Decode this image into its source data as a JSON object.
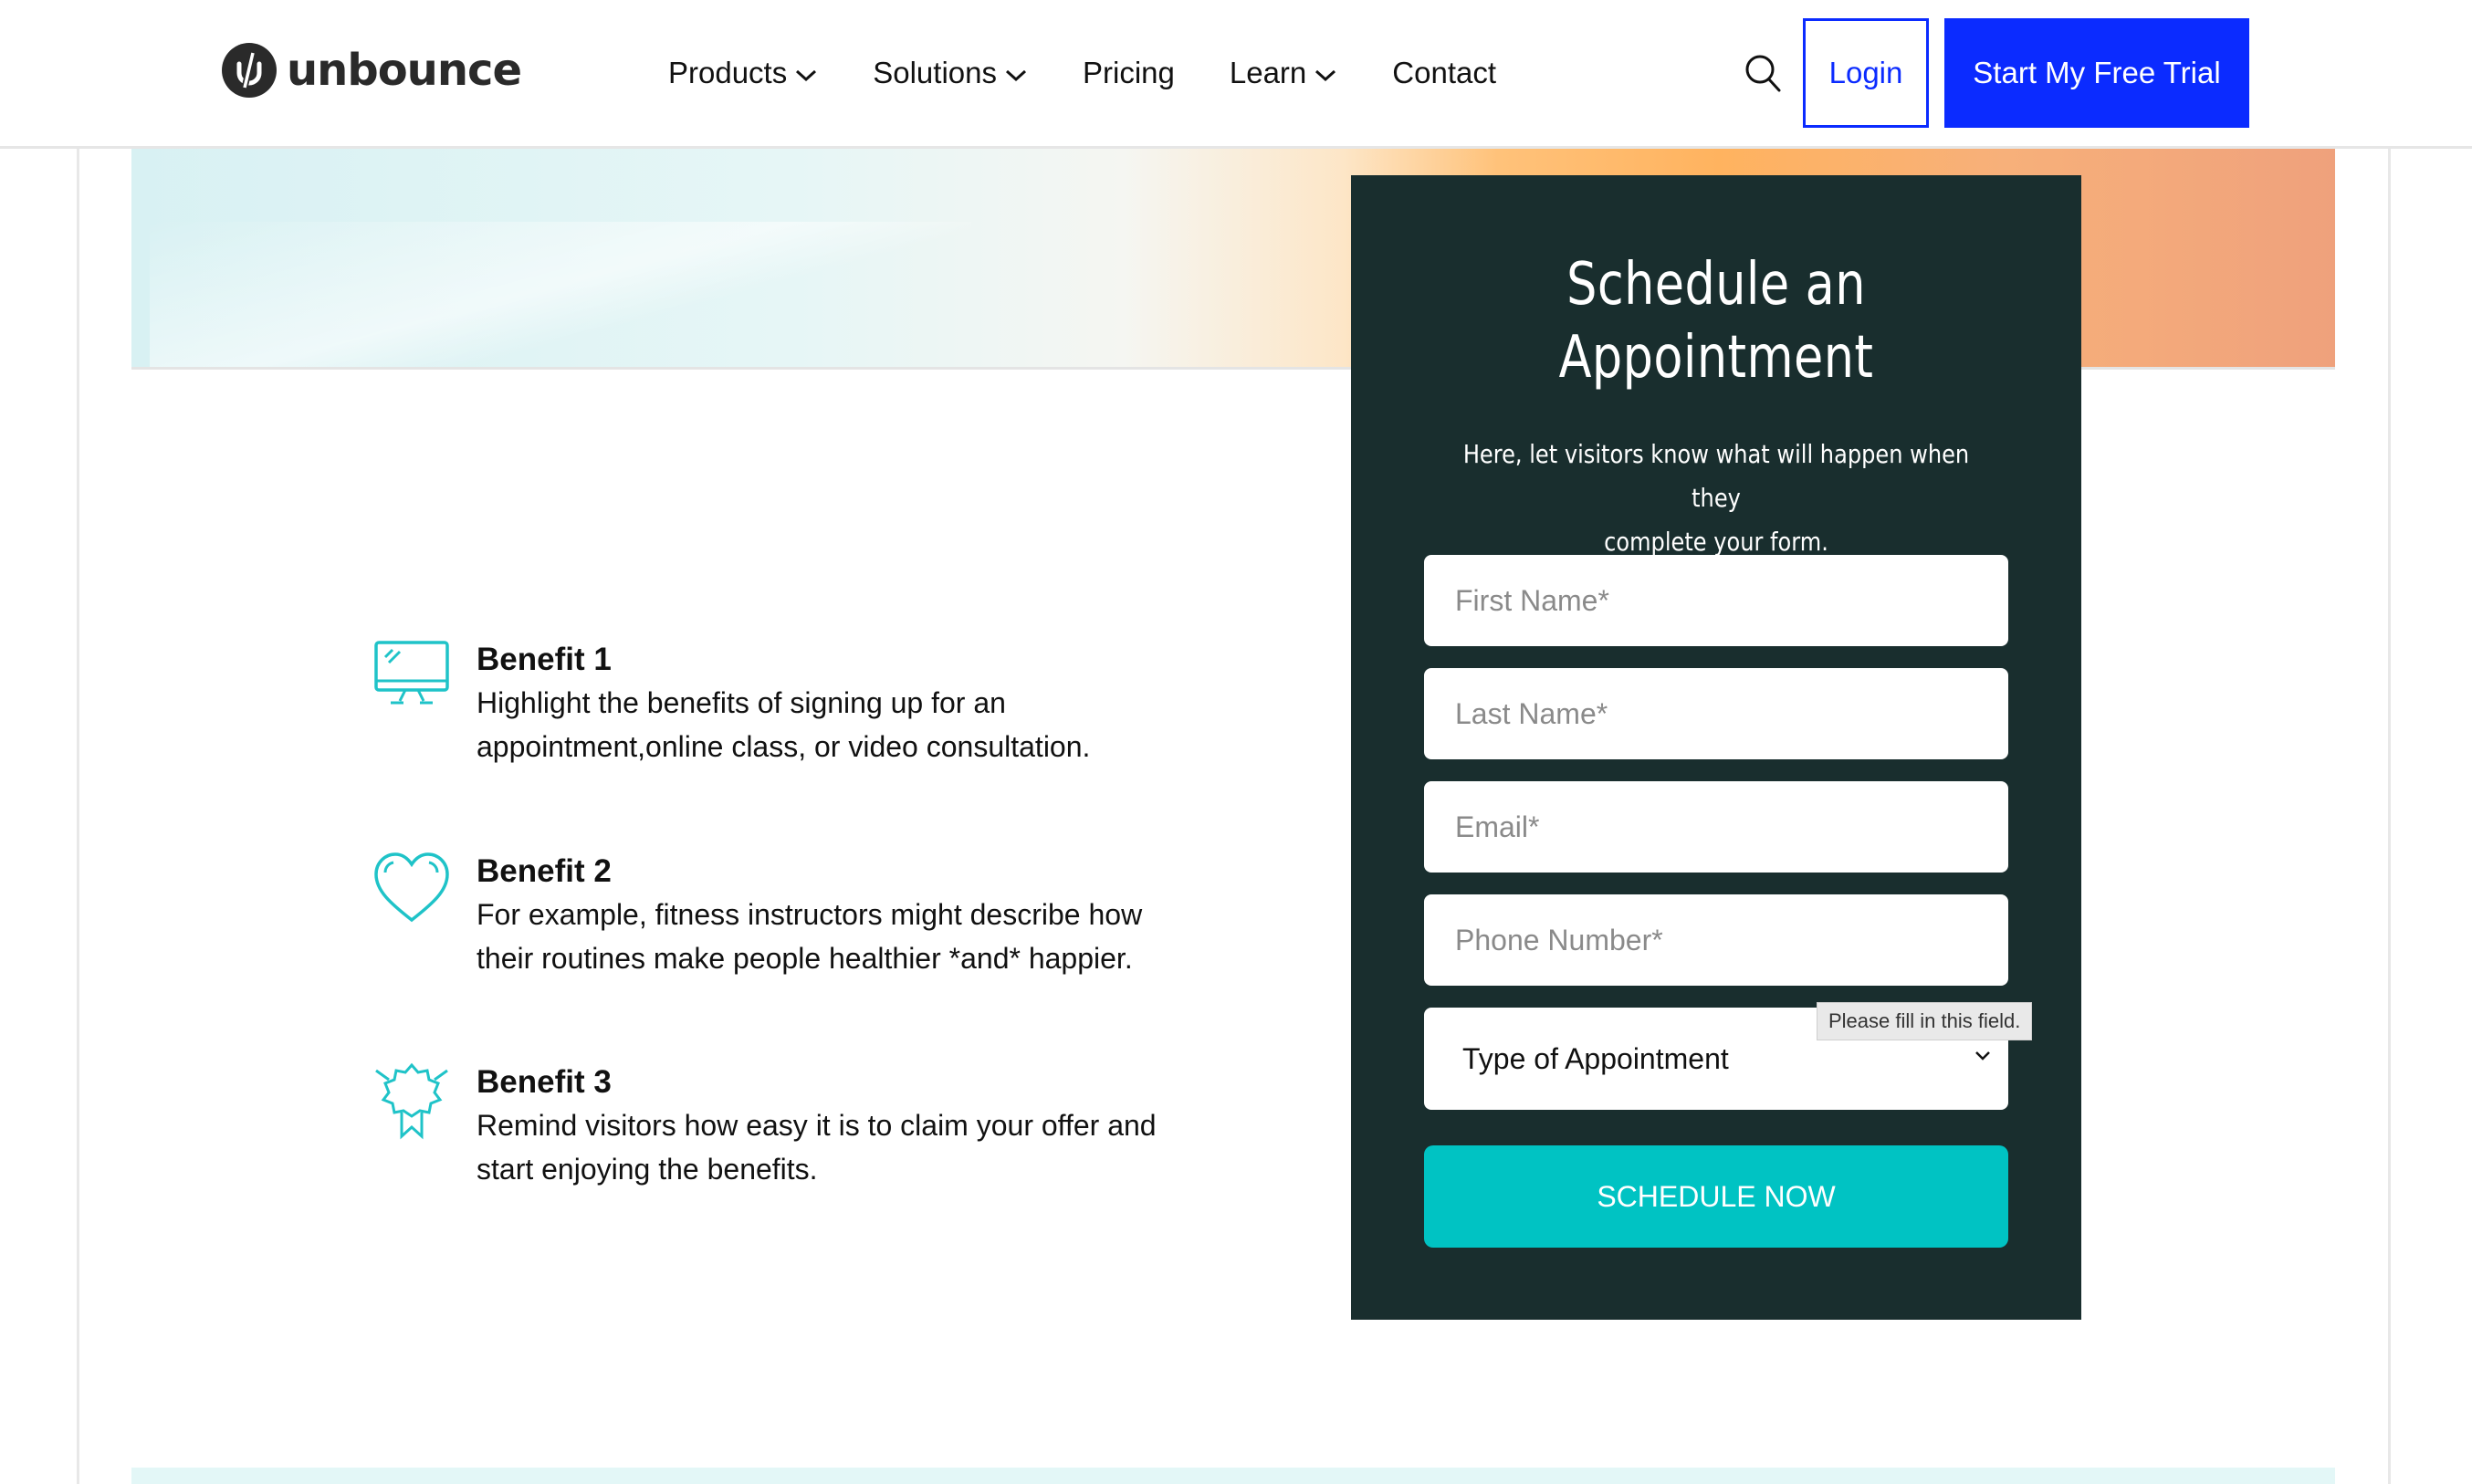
{
  "header": {
    "logo_text": "unbounce",
    "nav": [
      {
        "label": "Products",
        "has_dropdown": true
      },
      {
        "label": "Solutions",
        "has_dropdown": true
      },
      {
        "label": "Pricing",
        "has_dropdown": false
      },
      {
        "label": "Learn",
        "has_dropdown": true
      },
      {
        "label": "Contact",
        "has_dropdown": false
      }
    ],
    "search_icon": "search-icon",
    "login_label": "Login",
    "trial_label": "Start My Free Trial"
  },
  "benefits": [
    {
      "icon": "monitor-icon",
      "title": "Benefit 1",
      "lines": [
        "Highlight the benefits of signing up for an",
        "appointment,online class, or video consultation."
      ]
    },
    {
      "icon": "heart-icon",
      "title": "Benefit 2",
      "lines": [
        "For example, fitness instructors might describe how",
        "their routines make people healthier *and* happier."
      ]
    },
    {
      "icon": "award-ribbon-icon",
      "title": "Benefit 3",
      "lines": [
        "Remind visitors how easy it is to claim your offer and",
        "start enjoying the benefits."
      ]
    }
  ],
  "form": {
    "title_line1": "Schedule an",
    "title_line2": "Appointment",
    "subtitle_line1": "Here, let visitors know what will happen when they",
    "subtitle_line2": "complete your form.",
    "fields": {
      "first_name": "First Name*",
      "last_name": "Last Name*",
      "email": "Email*",
      "phone": "Phone Number*"
    },
    "select_value": "Type of Appointment",
    "tooltip": "Please fill in this field.",
    "submit_label": "SCHEDULE NOW"
  },
  "colors": {
    "brand_blue": "#0b2bff",
    "form_bg": "#192e2e",
    "accent_teal": "#00c3c3",
    "icon_teal": "#1fc3c8"
  }
}
